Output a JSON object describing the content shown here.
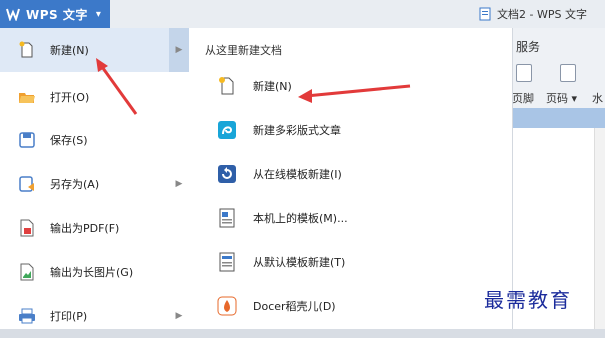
{
  "app": {
    "name": "WPS 文字",
    "document_title": "文档2 - WPS 文字"
  },
  "left_menu": {
    "items": [
      {
        "label": "新建(N)",
        "icon": "new-file-icon",
        "has_submenu": true,
        "active": true
      },
      {
        "label": "打开(O)",
        "icon": "folder-open-icon",
        "has_submenu": false
      },
      {
        "label": "保存(S)",
        "icon": "save-icon",
        "has_submenu": false
      },
      {
        "label": "另存为(A)",
        "icon": "save-as-icon",
        "has_submenu": true
      },
      {
        "label": "输出为PDF(F)",
        "icon": "pdf-export-icon",
        "has_submenu": false
      },
      {
        "label": "输出为长图片(G)",
        "icon": "image-export-icon",
        "has_submenu": false
      },
      {
        "label": "打印(P)",
        "icon": "printer-icon",
        "has_submenu": true
      }
    ]
  },
  "submenu": {
    "header": "从这里新建文档",
    "items": [
      {
        "label": "新建(N)",
        "icon": "new-file-icon"
      },
      {
        "label": "新建多彩版式文章",
        "icon": "colorful-article-icon"
      },
      {
        "label": "从在线模板新建(I)",
        "icon": "online-template-icon"
      },
      {
        "label": "本机上的模板(M)...",
        "icon": "local-template-icon"
      },
      {
        "label": "从默认模板新建(T)",
        "icon": "default-template-icon"
      },
      {
        "label": "Docer稻壳儿(D)",
        "icon": "docer-icon"
      }
    ]
  },
  "ribbon": {
    "tab_fragment": "服务",
    "labels": [
      "页脚",
      "页码 ▾",
      "水"
    ]
  },
  "watermark": "最需教育",
  "colors": {
    "accent": "#3c79c9",
    "annotation_arrow": "#e23a3a",
    "watermark": "#1c2c9c"
  }
}
